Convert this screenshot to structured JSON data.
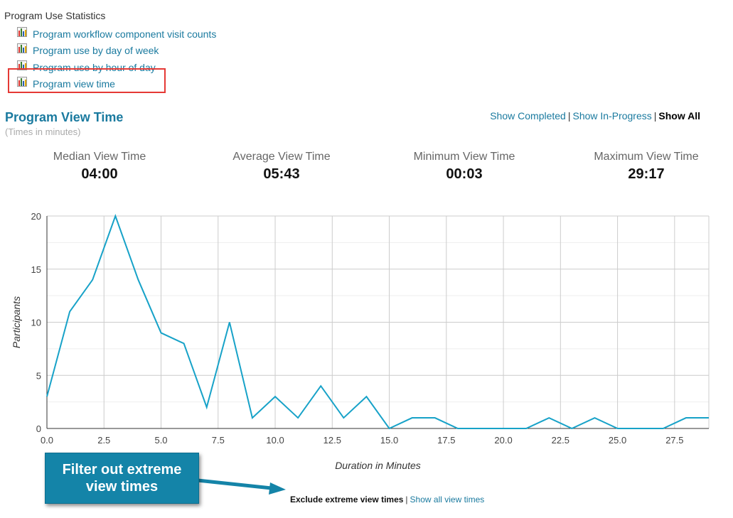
{
  "section": {
    "title": "Program Use Statistics"
  },
  "reports": [
    {
      "label": "Program workflow component visit counts",
      "icon": "bar-chart-icon"
    },
    {
      "label": "Program use by day of week",
      "icon": "bar-chart-icon"
    },
    {
      "label": "Program use by hour of day",
      "icon": "bar-chart-icon"
    },
    {
      "label": "Program view time",
      "icon": "bar-chart-icon"
    }
  ],
  "report": {
    "title": "Program View Time",
    "subtitle": "(Times in minutes)"
  },
  "filters": {
    "completed": "Show Completed",
    "in_progress": "Show In-Progress",
    "all": "Show All",
    "separator": "|"
  },
  "stats": {
    "median": {
      "label": "Median View Time",
      "value": "04:00"
    },
    "average": {
      "label": "Average View Time",
      "value": "05:43"
    },
    "minimum": {
      "label": "Minimum View Time",
      "value": "00:03"
    },
    "maximum": {
      "label": "Maximum View Time",
      "value": "29:17"
    }
  },
  "annotation": {
    "text": "Filter out extreme view times"
  },
  "bottom_links": {
    "exclude": "Exclude extreme view times",
    "separator": "|",
    "show_all": "Show all view times"
  },
  "colors": {
    "line": "#17a2c8",
    "link": "#1a7a9f",
    "highlight": "#e53935",
    "annotation_bg": "#1484a8"
  },
  "chart_data": {
    "type": "line",
    "xlabel": "Duration in Minutes",
    "ylabel": "Participants",
    "xlim": [
      0,
      29
    ],
    "ylim": [
      0,
      20
    ],
    "x_ticks": [
      "0.0",
      "2.5",
      "5.0",
      "7.5",
      "10.0",
      "12.5",
      "15.0",
      "17.5",
      "20.0",
      "22.5",
      "25.0",
      "27.5"
    ],
    "y_ticks": [
      "0",
      "5",
      "10",
      "15",
      "20"
    ],
    "grid": true,
    "x": [
      0,
      1,
      2,
      3,
      4,
      5,
      6,
      7,
      8,
      9,
      10,
      11,
      12,
      13,
      14,
      15,
      16,
      17,
      18,
      19,
      20,
      21,
      22,
      23,
      24,
      25,
      26,
      27,
      28,
      29
    ],
    "values": [
      3,
      11,
      14,
      20,
      14,
      9,
      8,
      2,
      10,
      1,
      3,
      1,
      4,
      1,
      3,
      0,
      1,
      1,
      0,
      0,
      0,
      0,
      1,
      0,
      1,
      0,
      0,
      0,
      1,
      1
    ]
  }
}
